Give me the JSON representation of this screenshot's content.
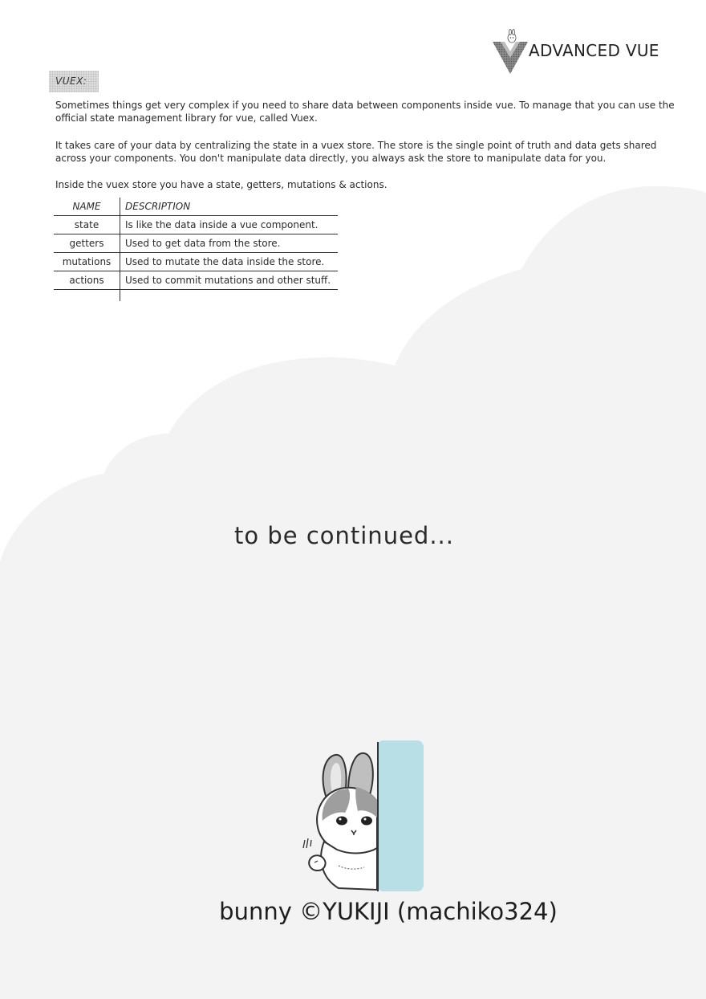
{
  "header": {
    "logo_text": "ADVANCED VUE"
  },
  "section": {
    "tag": "VUEX:"
  },
  "paragraphs": [
    "Sometimes things get very complex if you need to share data between components inside vue. To manage that you can use the official state management library for vue, called Vuex.",
    "It takes care of your data by centralizing the state in a vuex store. The store is the single point of truth and data gets shared across your components. You don't manipulate data directly, you always ask the store to manipulate data for you.",
    "Inside the vuex store you have a state, getters, mutations & actions."
  ],
  "table": {
    "headers": [
      "NAME",
      "DESCRIPTION"
    ],
    "rows": [
      [
        "state",
        "Is like the data inside a vue component."
      ],
      [
        "getters",
        "Used to get data from the store."
      ],
      [
        "mutations",
        "Used to mutate the data inside the store."
      ],
      [
        "actions",
        "Used to commit mutations and other stuff."
      ]
    ]
  },
  "footer": {
    "continued": "to be continued...",
    "credit": "bunny ©YUKIJI (machiko324)"
  },
  "colors": {
    "cloud": "#f3f3f3",
    "bunny_wall": "#b9dfe6",
    "section_tag_bg": "#dcdcdc"
  },
  "icons": {
    "logo": "vue-v-logo-with-bunny-icon",
    "illustration": "bunny-peeking-illustration"
  }
}
